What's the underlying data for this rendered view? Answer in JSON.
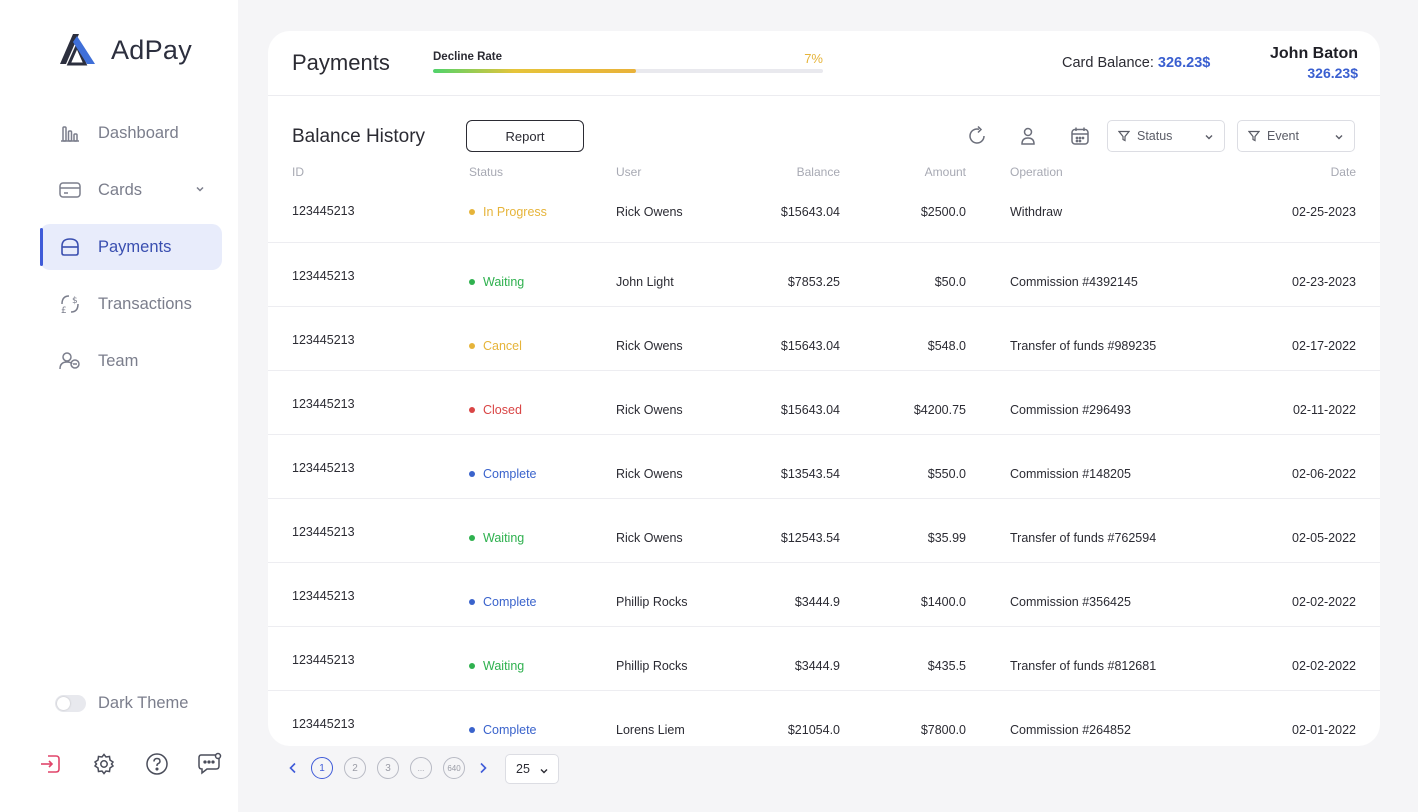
{
  "brand": {
    "name": "AdPay"
  },
  "sidebar": {
    "items": [
      {
        "label": "Dashboard",
        "icon": "bar-chart-icon"
      },
      {
        "label": "Cards",
        "icon": "credit-card-icon",
        "has_chevron": true
      },
      {
        "label": "Payments",
        "icon": "wallet-icon",
        "active": true
      },
      {
        "label": "Transactions",
        "icon": "currency-exchange-icon"
      },
      {
        "label": "Team",
        "icon": "team-icon"
      }
    ],
    "theme_toggle_label": "Dark Theme",
    "bottom_icons": [
      "logout-icon",
      "gear-icon",
      "help-icon",
      "chat-icon"
    ]
  },
  "header": {
    "title": "Payments",
    "decline_rate_label": "Decline Rate",
    "decline_rate_value": "7%",
    "decline_rate_fill_fraction": 0.52,
    "card_balance_label": "Card Balance:",
    "card_balance_value": "326.23$",
    "user_name": "John Baton",
    "user_balance": "326.23$"
  },
  "section": {
    "title": "Balance History",
    "report_label": "Report",
    "filter_status_label": "Status",
    "filter_event_label": "Event"
  },
  "table": {
    "headers": {
      "id": "ID",
      "status": "Status",
      "user": "User",
      "balance": "Balance",
      "amount": "Amount",
      "operation": "Operation",
      "date": "Date"
    },
    "rows": [
      {
        "id": "123445213",
        "status": "In Progress",
        "status_color": "#e6b43a",
        "user": "Rick Owens",
        "balance": "$15643.04",
        "amount": "$2500.0",
        "operation": "Withdraw",
        "date": "02-25-2023"
      },
      {
        "id": "123445213",
        "status": "Waiting",
        "status_color": "#2fb14f",
        "user": "John Light",
        "balance": "$7853.25",
        "amount": "$50.0",
        "operation": "Commission #4392145",
        "date": "02-23-2023"
      },
      {
        "id": "123445213",
        "status": "Cancel",
        "status_color": "#e6b43a",
        "user": "Rick Owens",
        "balance": "$15643.04",
        "amount": "$548.0",
        "operation": "Transfer of funds #989235",
        "date": "02-17-2022"
      },
      {
        "id": "123445213",
        "status": "Closed",
        "status_color": "#d94545",
        "user": "Rick Owens",
        "balance": "$15643.04",
        "amount": "$4200.75",
        "operation": "Commission #296493",
        "date": "02-11-2022"
      },
      {
        "id": "123445213",
        "status": "Complete",
        "status_color": "#3a63cc",
        "user": "Rick Owens",
        "balance": "$13543.54",
        "amount": "$550.0",
        "operation": "Commission #148205",
        "date": "02-06-2022"
      },
      {
        "id": "123445213",
        "status": "Waiting",
        "status_color": "#2fb14f",
        "user": "Rick Owens",
        "balance": "$12543.54",
        "amount": "$35.99",
        "operation": "Transfer of funds #762594",
        "date": "02-05-2022"
      },
      {
        "id": "123445213",
        "status": "Complete",
        "status_color": "#3a63cc",
        "user": "Phillip Rocks",
        "balance": "$3444.9",
        "amount": "$1400.0",
        "operation": "Commission #356425",
        "date": "02-02-2022"
      },
      {
        "id": "123445213",
        "status": "Waiting",
        "status_color": "#2fb14f",
        "user": "Phillip Rocks",
        "balance": "$3444.9",
        "amount": "$435.5",
        "operation": "Transfer of funds #812681",
        "date": "02-02-2022"
      },
      {
        "id": "123445213",
        "status": "Complete",
        "status_color": "#3a63cc",
        "user": "Lorens Liem",
        "balance": "$21054.0",
        "amount": "$7800.0",
        "operation": "Commission #264852",
        "date": "02-01-2022"
      }
    ]
  },
  "pagination": {
    "pages": [
      "1",
      "2",
      "3",
      "...",
      "640"
    ],
    "current": "1",
    "per_page": "25"
  },
  "colors": {
    "accent": "#3f5bd8",
    "active_bg": "#e8ecfb"
  }
}
